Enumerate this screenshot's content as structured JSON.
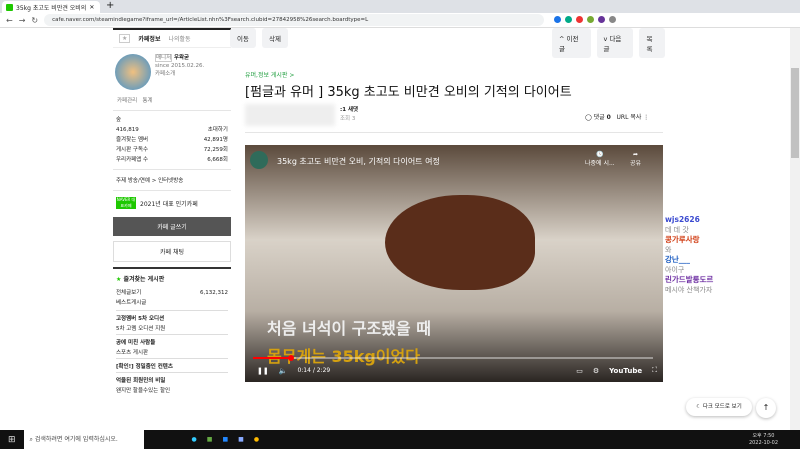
{
  "browser": {
    "tab_title": "35kg 초고도 비만견 오비의",
    "url": "cafe.naver.com/steamindiegame?iframe_url=/ArticleList.nhn%3Fsearch.clubid=27842958%26search.boardtype=L"
  },
  "sidebar": {
    "tab_info": "카페정보",
    "tab_activity": "나의활동",
    "manager_badge": "매니저",
    "manager": "우왁굳",
    "since": "since 2015.02.26.",
    "intro": "카페소개",
    "manage": "카페관리",
    "stats": "통계",
    "level": "숲",
    "members": "416,819",
    "invite": "초대하기",
    "rows": [
      {
        "label": "즐겨찾는 멤버",
        "value": "42,891명"
      },
      {
        "label": "게시판 구독수",
        "value": "72,259회"
      },
      {
        "label": "우리카페앱 수",
        "value": "6,668회"
      }
    ],
    "theme": "주제 방송/연예 > 인터넷방송",
    "naver_badge": "NAVER 대표카페",
    "award": "2021년 대표 인기카페",
    "write": "카페 글쓰기",
    "chat": "카페 채팅",
    "fav_boards": "즐겨찾는 게시판",
    "boards": [
      {
        "label": "전체글보기",
        "count": "6,132,312"
      },
      {
        "label": "베스트게시글"
      },
      {
        "label": "고정멤버 5차 오디션",
        "header": true
      },
      {
        "label": "5차 고멤 오디션 지원"
      },
      {
        "label": "공에 미친 사람들",
        "header": true
      },
      {
        "label": "스포츠 게시판"
      },
      {
        "label": "[확인!] 정밀줌인 컨텐츠",
        "header": true
      },
      {
        "label": "억울된 회원민의 비밀",
        "header": true
      },
      {
        "label": "왠지만 할을수있는 할인"
      }
    ]
  },
  "toolbar": {
    "move": "이동",
    "delete": "삭제",
    "prev": "이전글",
    "next": "다음글",
    "list": "목록"
  },
  "article": {
    "board": "유머,정보 게시판 >",
    "title": "[펌글과 유머 ] 35kg 초고도 비만견 오비의 기적의 다이어트",
    "author_level": ":1 새댓",
    "views": "조회 3",
    "comments_label": "댓글",
    "comments": "0",
    "url_copy": "URL 복사"
  },
  "video": {
    "title": "35kg 초고도 비만견 오비, 기적의 다이어트 여정",
    "later": "나중에 시...",
    "share": "공유",
    "caption1": "처음 녀석이 구조됐을 때",
    "caption2": "몸무게는 35kg이었다",
    "time": "0:14 / 2:29",
    "brand": "YouTube",
    "progress": 0.094
  },
  "chat": [
    {
      "user": "wjs2626",
      "msg": "데 데 갓",
      "color": "#3b4bd0"
    },
    {
      "user": "콩가루사랑",
      "msg": "와",
      "color": "#d03a10"
    },
    {
      "user": "강난___",
      "msg": "아이구",
      "color": "#1a5bc0"
    },
    {
      "user": "린가드발롱도르",
      "msg": "메시야 산책가자",
      "color": "#6a2aa0"
    }
  ],
  "dark_mode": "다크 모드로 보기",
  "taskbar": {
    "search": "검색하려면 여기에 입력하십시오.",
    "time": "오후 7:50",
    "date": "2022-10-02"
  }
}
